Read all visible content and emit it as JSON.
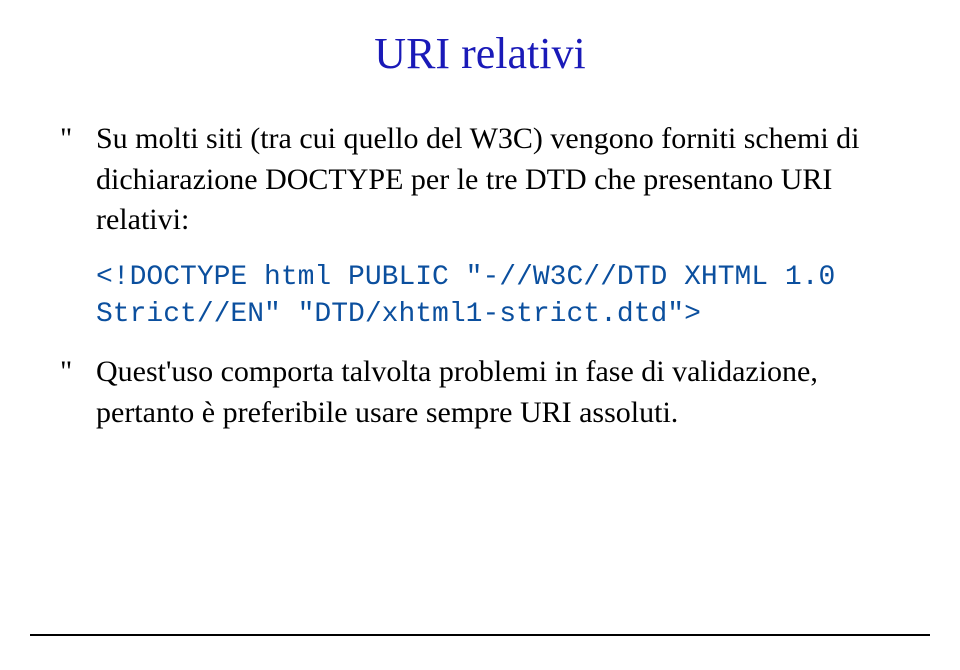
{
  "title": "URI relativi",
  "bullet_glyph": "\"",
  "para1": "Su molti siti (tra cui quello del W3C) vengono forniti schemi di dichiarazione DOCTYPE per le tre DTD che presentano URI relativi:",
  "code_line1": "<!DOCTYPE html PUBLIC \"-//W3C//DTD XHTML 1.0",
  "code_line2": "Strict//EN\" \"DTD/xhtml1-strict.dtd\">",
  "para2": "Quest'uso comporta talvolta problemi in fase di validazione, pertanto è preferibile usare sempre URI assoluti."
}
